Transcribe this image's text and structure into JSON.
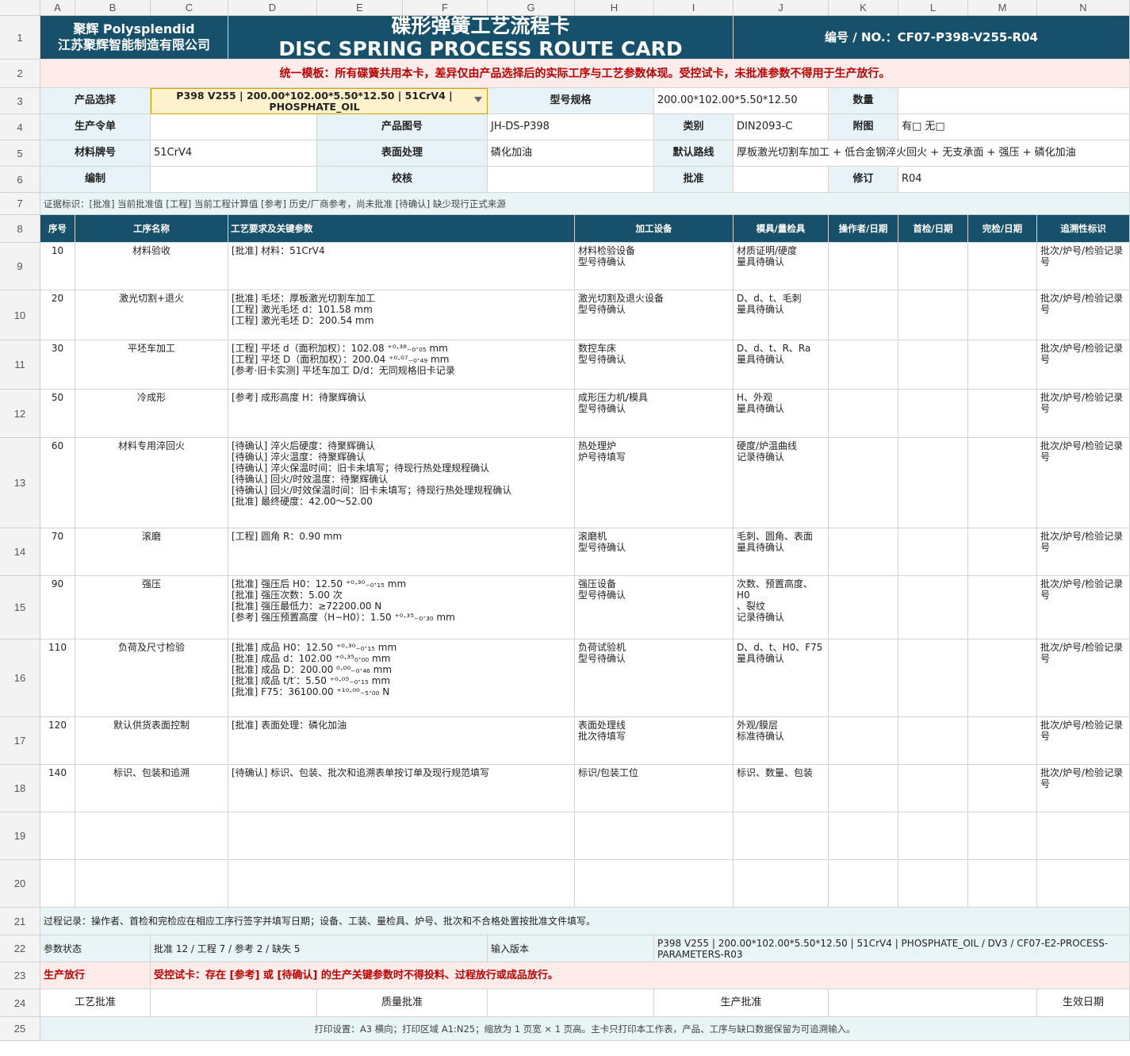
{
  "columns": [
    "A",
    "B",
    "C",
    "D",
    "E",
    "F",
    "G",
    "H",
    "I",
    "J",
    "K",
    "L",
    "M",
    "N"
  ],
  "row_numbers": [
    "1",
    "2",
    "3",
    "4",
    "5",
    "6",
    "7",
    "8",
    "9",
    "10",
    "11",
    "12",
    "13",
    "14",
    "15",
    "16",
    "17",
    "18",
    "19",
    "20",
    "21",
    "22",
    "23",
    "24",
    "25"
  ],
  "header": {
    "company_line1": "聚辉 Polysplendid",
    "company_line2": "江苏聚辉智能制造有限公司",
    "title_cn": "碟形弹簧工艺流程卡",
    "title_en": "DISC SPRING PROCESS ROUTE CARD",
    "doc_number": "编号 / NO.：CF07-P398-V255-R04"
  },
  "notice": "统一模板：所有碟簧共用本卡，差异仅由产品选择后的实际工序与工艺参数体现。受控试卡，未批准参数不得用于生产放行。",
  "info": {
    "product_select_label": "产品选择",
    "product_select_value": "P398 V255 | 200.00*102.00*5.50*12.50 | 51CrV4 | PHOSPHATE_OIL",
    "spec_label": "型号规格",
    "spec_value": "200.00*102.00*5.50*12.50",
    "qty_label": "数量",
    "qty_value": "",
    "order_label": "生产令单",
    "order_value": "",
    "drawing_label": "产品图号",
    "drawing_value": "JH-DS-P398",
    "category_label": "类别",
    "category_value": "DIN2093-C",
    "attach_label": "附图",
    "attach_value": "有□  无□",
    "material_label": "材料牌号",
    "material_value": "51CrV4",
    "surface_label": "表面处理",
    "surface_value": "磷化加油",
    "route_label": "默认路线",
    "route_value": "厚板激光切割车加工 + 低合金钢淬火回火 + 无支承面 + 强压 + 磷化加油",
    "prepared_label": "编制",
    "checked_label": "校核",
    "approved_label": "批准",
    "revision_label": "修订",
    "revision_value": "R04"
  },
  "evidence_legend": "证据标识：[批准] 当前批准值   [工程] 当前工程计算值   [参考] 历史/厂商参考，尚未批准   [待确认] 缺少现行正式来源",
  "table_headers": {
    "seq": "序号",
    "name": "工序名称",
    "params": "工艺要求及关键参数",
    "equipment": "加工设备",
    "tools": "模具/量检具",
    "operator": "操作者/日期",
    "first": "首检/日期",
    "final": "完检/日期",
    "trace": "追溯性标识"
  },
  "operations": [
    {
      "seq": "10",
      "name": "材料验收",
      "params": "[批准] 材料：51CrV4",
      "equipment": "材料检验设备\n型号待确认",
      "tools": "材质证明/硬度\n量具待确认",
      "trace": "批次/炉号/检验记录号"
    },
    {
      "seq": "20",
      "name": "激光切割+退火",
      "params": "[批准] 毛坯：厚板激光切割车加工\n[工程] 激光毛坯 d：101.58 mm\n[工程] 激光毛坯 D：200.54 mm",
      "equipment": "激光切割及退火设备\n型号待确认",
      "tools": "D、d、t、毛刺\n量具待确认",
      "trace": "批次/炉号/检验记录号"
    },
    {
      "seq": "30",
      "name": "平坯车加工",
      "params": "[工程] 平坯 d（面积加权）：102.08 ⁺⁰·³⁸₋₀·₀₅ mm\n[工程] 平坯 D（面积加权）：200.04 ⁺⁰·⁰⁷₋₀·₄₉ mm\n[参考·旧卡实测] 平坯车加工 D/d：无同规格旧卡记录",
      "equipment": "数控车床\n型号待确认",
      "tools": "D、d、t、R、Ra\n量具待确认",
      "trace": "批次/炉号/检验记录号"
    },
    {
      "seq": "50",
      "name": "冷成形",
      "params": "[参考] 成形高度 H：待聚辉确认",
      "equipment": "成形压力机/模具\n型号待确认",
      "tools": "H、外观\n量具待确认",
      "trace": "批次/炉号/检验记录号"
    },
    {
      "seq": "60",
      "name": "材料专用淬回火",
      "params": "[待确认] 淬火后硬度：待聚辉确认\n[待确认] 淬火温度：待聚辉确认\n[待确认] 淬火保温时间：旧卡未填写；待现行热处理规程确认\n[待确认] 回火/时效温度：待聚辉确认\n[待确认] 回火/时效保温时间：旧卡未填写；待现行热处理规程确认\n[批准] 最终硬度：42.00～52.00",
      "equipment": "热处理炉\n炉号待填写",
      "tools": "硬度/炉温曲线\n记录待确认",
      "trace": "批次/炉号/检验记录号"
    },
    {
      "seq": "70",
      "name": "滚磨",
      "params": "[工程] 圆角 R：0.90 mm",
      "equipment": "滚磨机\n型号待确认",
      "tools": "毛刺、圆角、表面\n量具待确认",
      "trace": "批次/炉号/检验记录号"
    },
    {
      "seq": "90",
      "name": "强压",
      "params": "[批准] 强压后 H0：12.50 ⁺⁰·³⁰₋₀·₁₅ mm\n[批准] 强压次数：5.00 次\n[批准] 强压最低力：≥72200.00 N\n[参考] 强压预置高度（H−H0）：1.50 ⁺⁰·³⁵₋₀·₃₀ mm",
      "equipment": "强压设备\n型号待确认",
      "tools": "次数、预置高度、H0\n、裂纹\n记录待确认",
      "trace": "批次/炉号/检验记录号"
    },
    {
      "seq": "110",
      "name": "负荷及尺寸检验",
      "params": "[批准] 成品 H0：12.50 ⁺⁰·³⁰₋₀·₁₅ mm\n[批准] 成品 d：102.00 ⁺⁰·³⁵₀·₀₀ mm\n[批准] 成品 D：200.00 ⁰·⁰⁰₋₀·₄₆ mm\n[批准] 成品 t/t′：5.50 ⁺⁰·⁰⁵₋₀·₁₅ mm\n[批准] F75：36100.00 ⁺¹⁰·⁰⁰₋₅·₀₀ N",
      "equipment": "负荷试验机\n型号待确认",
      "tools": "D、d、t、H0、F75\n量具待确认",
      "trace": "批次/炉号/检验记录号"
    },
    {
      "seq": "120",
      "name": "默认供货表面控制",
      "params": "[批准] 表面处理：磷化加油",
      "equipment": "表面处理线\n批次待填写",
      "tools": "外观/膜层\n标准待确认",
      "trace": "批次/炉号/检验记录号"
    },
    {
      "seq": "140",
      "name": "标识、包装和追溯",
      "params": "[待确认] 标识、包装、批次和追溯表单按订单及现行规范填写",
      "equipment": "标识/包装工位",
      "tools": "标识、数量、包装",
      "trace": "批次/炉号/检验记录号"
    }
  ],
  "process_record_note": "过程记录：操作者、首检和完检应在相应工序行签字并填写日期；设备、工装、量检具、炉号、批次和不合格处置按批准文件填写。",
  "param_status_label": "参数状态",
  "param_status_value": "批准 12 / 工程 7 / 参考 2 / 缺失 5",
  "input_version_label": "输入版本",
  "input_version_value": "P398 V255 | 200.00*102.00*5.50*12.50 | 51CrV4 | PHOSPHATE_OIL / DV3 / CF07-E2-PROCESS-PARAMETERS-R03",
  "release_label": "生产放行",
  "release_value": "受控试卡：存在 [参考] 或 [待确认] 的生产关键参数时不得投料、过程放行或成品放行。",
  "sign": {
    "process": "工艺批准",
    "quality": "质量批准",
    "production": "生产批准",
    "effective": "生效日期"
  },
  "print_note": "打印设置：A3 横向；打印区域 A1:N25；缩放为 1 页宽 × 1 页高。主卡只打印本工作表，产品、工序与缺口数据保留为可追溯输入。",
  "colors": {
    "header_dark": "#17506a",
    "label_bg": "#e8f3f7",
    "notice_bg": "#fdecea",
    "notice_text": "#c00000",
    "select_bg": "#fdf2cc"
  }
}
